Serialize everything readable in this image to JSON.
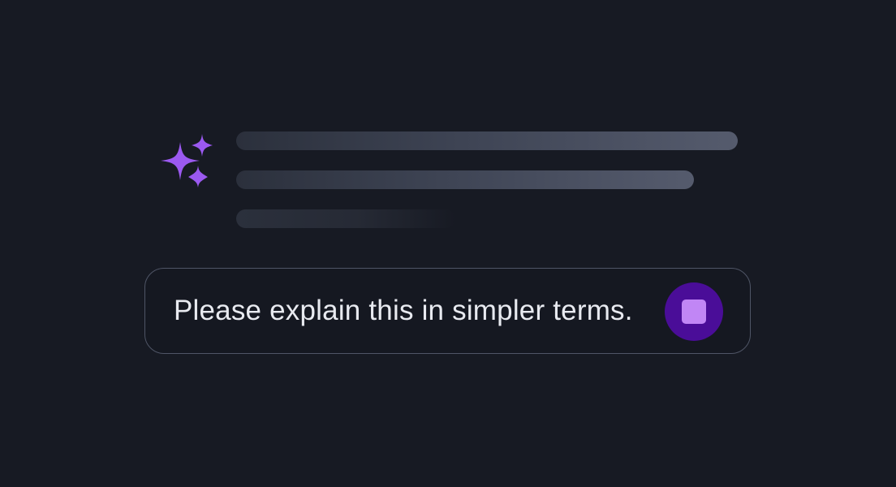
{
  "response": {
    "status": "generating",
    "icon": "sparkles-icon",
    "accent_color": "#9b59f0"
  },
  "composer": {
    "message": "Please explain this in simpler terms.",
    "stop_button_icon": "stop-icon",
    "stop_button_color": "#4a0d98"
  }
}
